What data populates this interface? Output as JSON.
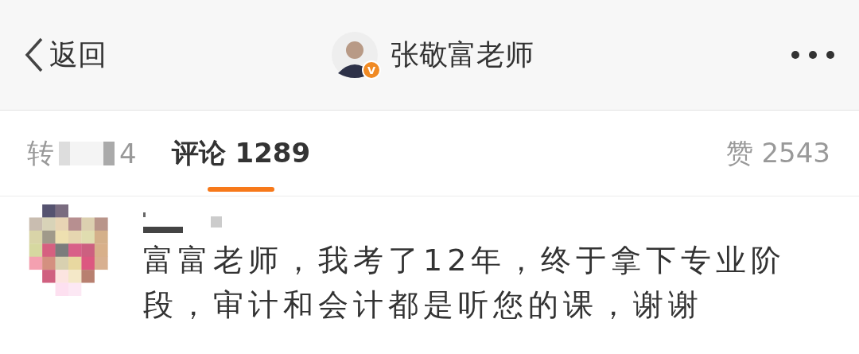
{
  "nav": {
    "back_label": "返回",
    "title": "张敬富老师",
    "verified_badge": "V"
  },
  "tabs": [
    {
      "label": "转",
      "count": "4",
      "blurred": true,
      "selected": false
    },
    {
      "label": "评论",
      "count": "1289",
      "blurred": false,
      "selected": true
    }
  ],
  "likes": {
    "label": "赞",
    "count": "2543"
  },
  "comments": [
    {
      "text": "富富老师，我考了12年，终于拿下专业阶段，审计和会计都是听您的课，谢谢"
    }
  ]
}
